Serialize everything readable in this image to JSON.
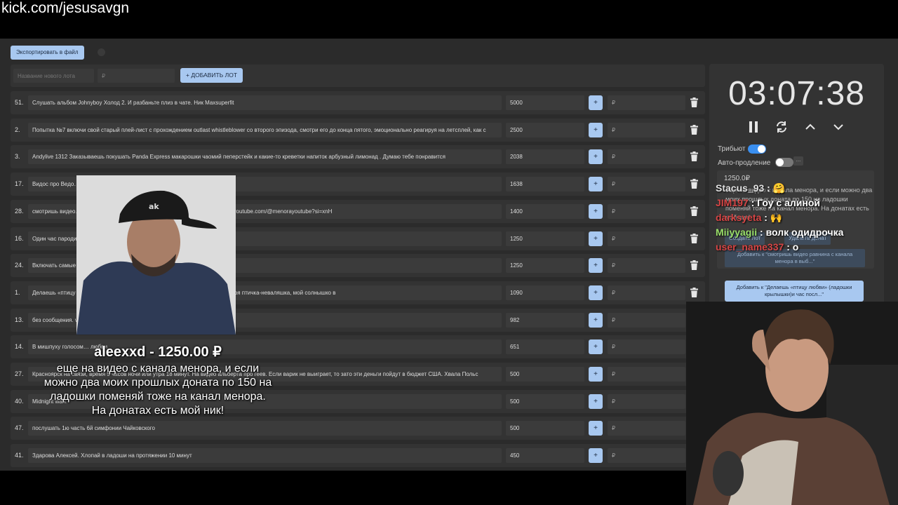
{
  "url": "kick.com/jesusavgn",
  "toolbar": {
    "export_label": "Экспортировать в файл"
  },
  "add_lot": {
    "name_placeholder": "Название нового лота",
    "price_placeholder": "₽",
    "add_label": "+ ДОБАВИТЬ ЛОТ"
  },
  "lots": [
    {
      "num": "51.",
      "name": "Слушать альбом Johnyboy Холод 2. И разбаньте плиз в чате. Ник Maxsuperfit",
      "amount": "5000"
    },
    {
      "num": "2.",
      "name": "Попытка №7 включи свой старый плей-лист с прохождением outlast whistleblower со второго эпизода, смотри его до конца пятого, эмоционально реагируя на летсплей, как с",
      "amount": "2500"
    },
    {
      "num": "3.",
      "name": "Andylive 1312 Заказываешь покушать Panda Express макарошки чаомий пеперстейк и какие-то креветки напиток арбузный лимонад . Думаю тебе понравится",
      "amount": "2038"
    },
    {
      "num": "17.",
      "name": "Видос про Ведо…                                                                                 3NyDGOtRO",
      "amount": "1638"
    },
    {
      "num": "28.",
      "name": "смотришь видео…                                                                                 видео если оно идет больше 30 минут. Вот ссылка https://youtube.com/@menorayoutube?si=xnH",
      "amount": "1400"
    },
    {
      "num": "16.",
      "name": "Один час пароди…                                                                                его манере",
      "amount": "1250"
    },
    {
      "num": "24.",
      "name": "Включать самые…                                                                                 анцевать и кайфовать",
      "amount": "1250"
    },
    {
      "num": "1.",
      "name": "Делаешь «птицу л…                                                                                камеры прыжками на месте чирикая: «Чирик чирик, я твоя птичка-неваляшка, мой солнышко в",
      "amount": "1090"
    },
    {
      "num": "13.",
      "name": "без сообщения.                                                                                  v.youtube.com/watch?v=ZfAaPOv_j6w",
      "amount": "982"
    },
    {
      "num": "14.",
      "name": "В мишпуху голосом…                                                                              любви",
      "amount": "651"
    },
    {
      "num": "27.",
      "name": "Красноярск на связи, время 5 часов ночи или утра 18 минут. На видео альберта про геев. Если варик не выиграет, то зато эти деньги пойдут в бюджет США. Хвала Польс",
      "amount": "500"
    },
    {
      "num": "40.",
      "name": "Midnight walk",
      "amount": "500"
    },
    {
      "num": "47.",
      "name": "послушать 1ю часть 6й симфонии Чайковского",
      "amount": "500"
    },
    {
      "num": "41.",
      "name": "Здарова Алексей. Хлопай в ладоши на протяжении 10 минут",
      "amount": "450"
    }
  ],
  "lot_controls": {
    "plus": "+",
    "rub": "₽"
  },
  "timer": {
    "value": "03:07:38"
  },
  "toggles": {
    "tribute_label": "Трибьют",
    "autoextend_label": "Авто-продление",
    "more": "..."
  },
  "subpanel": {
    "amount": "1250.0₽",
    "text": "еще на видео с канала менора, и если можно два моих прошлых доната по 150 на ладошки поменяй тоже на канал менора. На донатах есть мой ник!",
    "create_lot": "Создать лот",
    "delete_donation": "Удалить донат",
    "add_to_1": "Добавить к \"смотришь видео равнина с канала менора в выб...\""
  },
  "add_to_btn": "Добавить к \"Делаешь «птицу любви» (ладошки крылышки)и час посл...\"",
  "chat": [
    {
      "user": "Stacus_93",
      "text": ": 🤗",
      "color": "#e0e0e0"
    },
    {
      "user": "JIM197",
      "text": ": Гоу с алиной",
      "color": "#d64545"
    },
    {
      "user": "darksyeta",
      "text": ": 🙌",
      "color": "#d64545"
    },
    {
      "user": "Miiyyagii",
      "text": ": волк одидрочка",
      "color": "#9be06a"
    },
    {
      "user": "user_name337",
      "text": ": о",
      "color": "#d64545"
    }
  ],
  "donation": {
    "title": "aleexxd - 1250.00 ₽",
    "text": "еще на видео с канала менора, и если можно два моих прошлых доната по 150 на ладошки поменяй тоже на канал менора. На донатах есть мой ник!"
  }
}
